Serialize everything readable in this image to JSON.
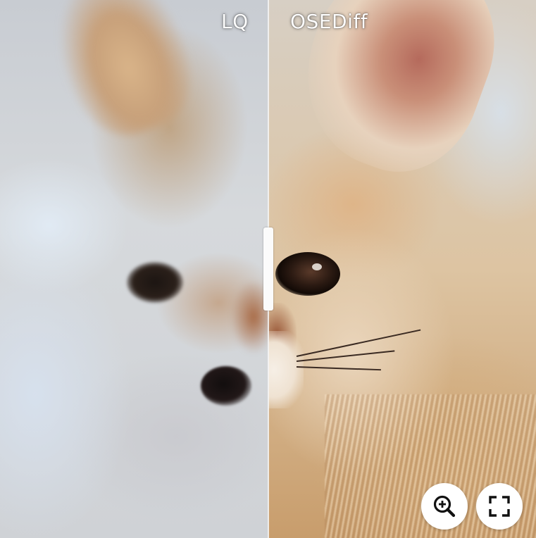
{
  "comparison": {
    "left_label": "LQ",
    "right_label": "OSEDiff",
    "slider_position": 0.5
  },
  "controls": {
    "zoom_icon": "zoom-in-icon",
    "fullscreen_icon": "fullscreen-icon"
  },
  "colors": {
    "label_text": "#ffffff",
    "button_background": "#ffffff",
    "icon_color": "#111111",
    "divider": "#f5f5f5"
  }
}
